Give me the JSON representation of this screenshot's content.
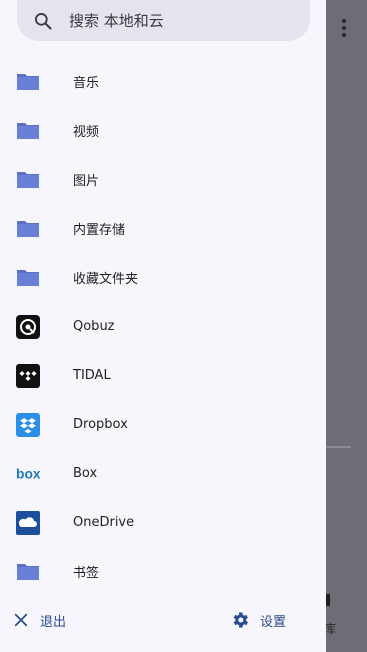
{
  "search": {
    "placeholder": "搜索 本地和云"
  },
  "drawer": {
    "items": [
      {
        "label": "音乐",
        "icon": "folder-icon"
      },
      {
        "label": "视频",
        "icon": "folder-icon"
      },
      {
        "label": "图片",
        "icon": "folder-icon"
      },
      {
        "label": "内置存储",
        "icon": "folder-icon"
      },
      {
        "label": "收藏文件夹",
        "icon": "folder-icon"
      },
      {
        "label": "Qobuz",
        "icon": "qobuz-icon"
      },
      {
        "label": "TIDAL",
        "icon": "tidal-icon"
      },
      {
        "label": "Dropbox",
        "icon": "dropbox-icon"
      },
      {
        "label": "Box",
        "icon": "box-icon"
      },
      {
        "label": "OneDrive",
        "icon": "onedrive-icon"
      },
      {
        "label": "书签",
        "icon": "folder-icon"
      }
    ],
    "footer": {
      "exit_label": "退出",
      "settings_label": "设置"
    }
  },
  "background": {
    "tab_label": "库"
  },
  "colors": {
    "folder": "#5a70c8",
    "accent": "#2b4d8f",
    "drawer_bg": "#f7f6fc",
    "scrim": "#6b6a72"
  }
}
